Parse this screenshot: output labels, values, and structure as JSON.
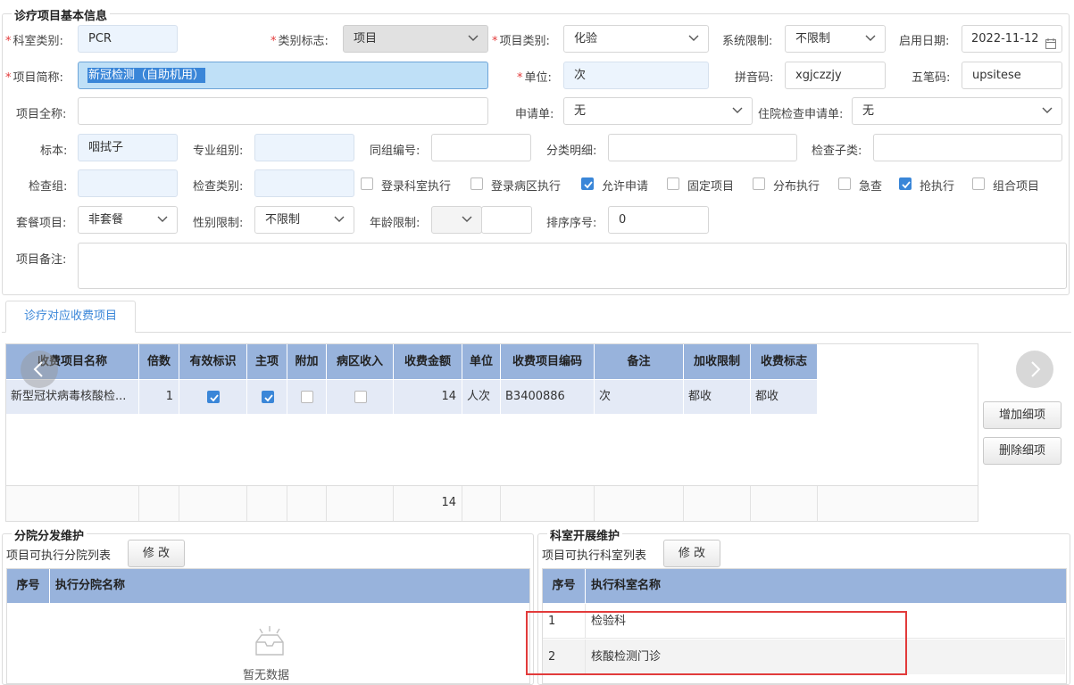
{
  "basic_section": {
    "title": "诊疗项目基本信息"
  },
  "form": {
    "dept_category": {
      "label": "科室类别:",
      "value": "PCR"
    },
    "category_flag": {
      "label": "类别标志:",
      "value": "项目"
    },
    "item_category": {
      "label": "项目类别:",
      "value": "化验"
    },
    "system_limit": {
      "label": "系统限制:",
      "value": "不限制"
    },
    "start_date": {
      "label": "启用日期:",
      "value": "2022-11-12"
    },
    "short_name": {
      "label": "项目简称:",
      "value": "新冠检测（自助机用）"
    },
    "unit": {
      "label": "单位:",
      "value": "次"
    },
    "pinyin": {
      "label": "拼音码:",
      "value": "xgjczzjy"
    },
    "wubi": {
      "label": "五笔码:",
      "value": "upsitese"
    },
    "full_name": {
      "label": "项目全称:",
      "value": ""
    },
    "request_form": {
      "label": "申请单:",
      "value": "无"
    },
    "inpatient_request": {
      "label": "住院检查申请单:",
      "value": "无"
    },
    "specimen": {
      "label": "标本:",
      "value": "咽拭子"
    },
    "specialty_group": {
      "label": "专业组别:",
      "value": ""
    },
    "group_number": {
      "label": "同组编号:",
      "value": ""
    },
    "class_detail": {
      "label": "分类明细:",
      "value": ""
    },
    "exam_subclass": {
      "label": "检查子类:",
      "value": ""
    },
    "exam_group": {
      "label": "检查组:",
      "value": ""
    },
    "exam_category": {
      "label": "检查类别:",
      "value": ""
    },
    "package_item": {
      "label": "套餐项目:",
      "value": "非套餐"
    },
    "gender_limit": {
      "label": "性别限制:",
      "value": "不限制"
    },
    "age_limit": {
      "label": "年龄限制:",
      "value": ""
    },
    "sort_order": {
      "label": "排序序号:",
      "value": "0"
    },
    "remarks": {
      "label": "项目备注:",
      "value": ""
    }
  },
  "checkboxes": [
    {
      "label": "登录科室执行",
      "checked": false
    },
    {
      "label": "登录病区执行",
      "checked": false
    },
    {
      "label": "允许申请",
      "checked": true
    },
    {
      "label": "固定项目",
      "checked": false
    },
    {
      "label": "分布执行",
      "checked": false
    },
    {
      "label": "急查",
      "checked": false
    },
    {
      "label": "抢执行",
      "checked": true
    },
    {
      "label": "组合项目",
      "checked": false
    }
  ],
  "tabs": [
    {
      "label": "诊疗对应收费项目"
    }
  ],
  "fee_table": {
    "headers": [
      "收费项目名称",
      "倍数",
      "有效标识",
      "主项",
      "附加",
      "病区收入",
      "收费金额",
      "单位",
      "收费项目编码",
      "备注",
      "加收限制",
      "收费标志"
    ],
    "rows": [
      {
        "name": "新型冠状病毒核酸检...",
        "multiple": "1",
        "valid": true,
        "main": true,
        "extra": false,
        "ward_income": false,
        "amount": "14",
        "unit": "人次",
        "code": "B3400886",
        "note": "次",
        "surcharge": "都收",
        "flag": "都收"
      }
    ],
    "footer": {
      "amount_total": "14"
    }
  },
  "buttons": {
    "add_detail": "增加细项",
    "delete_detail": "删除细项",
    "modify_branch": "修 改",
    "modify_dept": "修 改"
  },
  "branch_section": {
    "title": "分院分发维护",
    "list_label": "项目可执行分院列表",
    "headers": [
      "序号",
      "执行分院名称"
    ],
    "empty_text": "暂无数据"
  },
  "dept_section": {
    "title": "科室开展维护",
    "list_label": "项目可执行科室列表",
    "headers": [
      "序号",
      "执行科室名称"
    ],
    "rows": [
      {
        "index": "1",
        "name": "检验科"
      },
      {
        "index": "2",
        "name": "核酸检测门诊"
      }
    ]
  },
  "colors": {
    "accent": "#3a86d8",
    "table_header": "#98b3dc",
    "table_row": "#e4eaf6",
    "highlight_box": "#e23b3b"
  }
}
